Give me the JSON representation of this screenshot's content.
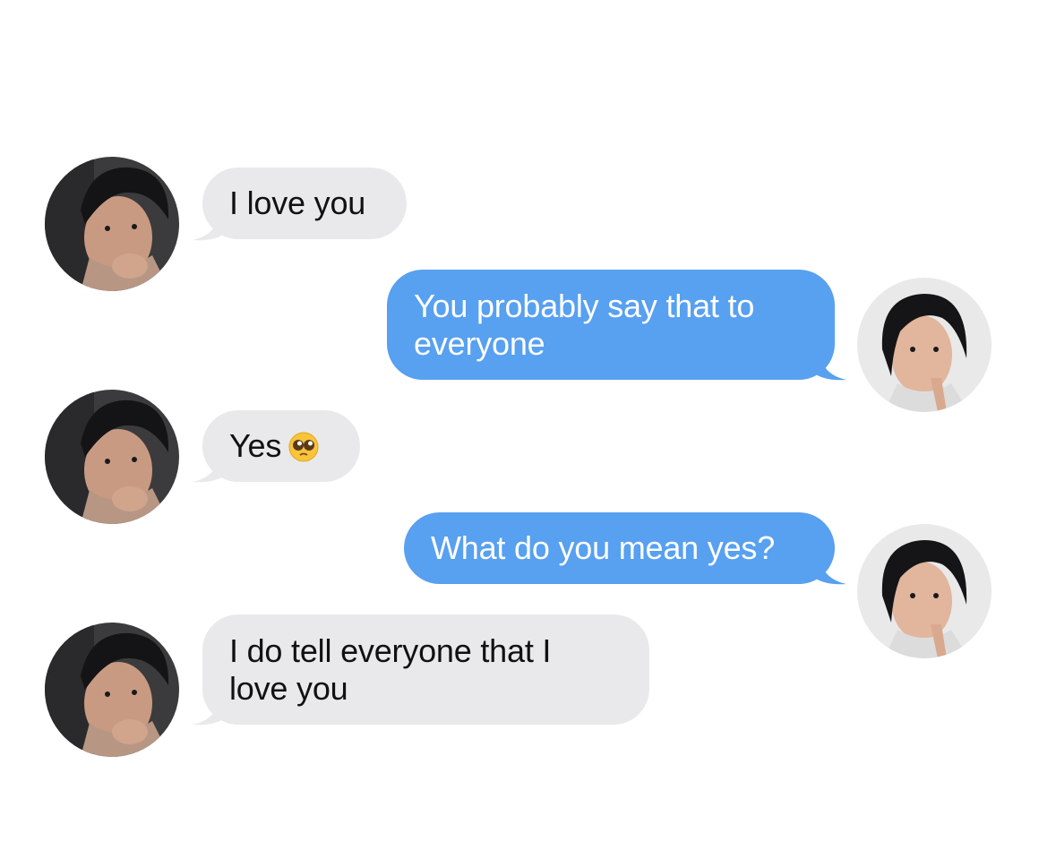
{
  "conversation": {
    "messages": [
      {
        "sender": "contact",
        "text": "I love you"
      },
      {
        "sender": "me",
        "text": "You probably say that to everyone"
      },
      {
        "sender": "contact",
        "text": "Yes",
        "emoji": "pleading-face-icon"
      },
      {
        "sender": "me",
        "text": "What do you mean yes?"
      },
      {
        "sender": "contact",
        "text": "I do tell everyone that I love you"
      }
    ]
  },
  "colors": {
    "incoming_bubble": "#e9e9eb",
    "outgoing_bubble": "#58a0f0",
    "incoming_text": "#111111",
    "outgoing_text": "#ffffff",
    "background": "#ffffff"
  },
  "icons": {
    "avatar_contact": "contact-avatar-photo",
    "avatar_me": "my-avatar-photo",
    "emoji": "pleading-face-icon"
  }
}
